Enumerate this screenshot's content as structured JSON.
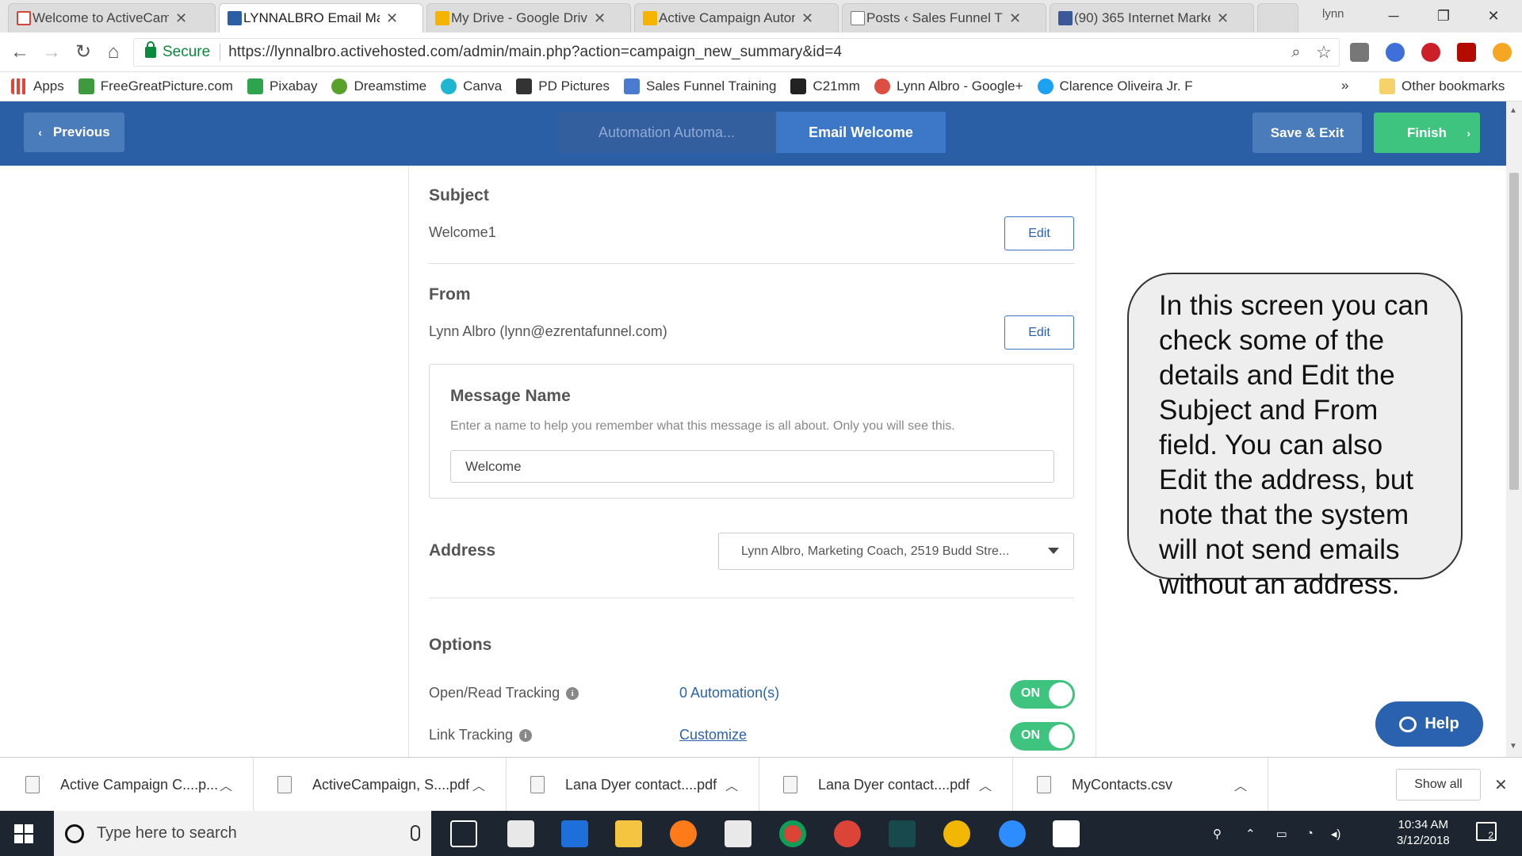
{
  "browser": {
    "tabs": [
      {
        "label": "Welcome to ActiveCam",
        "icon": "gmail-icon",
        "color": "#d44638"
      },
      {
        "label": "LYNNALBRO Email Mar",
        "icon": "activecampaign-icon",
        "color": "#2a5fa6"
      },
      {
        "label": "My Drive - Google Driv",
        "icon": "google-drive-icon",
        "color": "#f4b400"
      },
      {
        "label": "Active Campaign Auton",
        "icon": "google-slides-icon",
        "color": "#f4b400"
      },
      {
        "label": "Posts ‹ Sales Funnel Tra",
        "icon": "page-icon",
        "color": "#ffffff"
      },
      {
        "label": "(90) 365 Internet Marke",
        "icon": "facebook-icon",
        "color": "#3b5998"
      }
    ],
    "profile_name": "lynn",
    "secure_label": "Secure",
    "url": "https://lynnalbro.activehosted.com/admin/main.php?action=campaign_new_summary&id=4",
    "bookmarks": [
      {
        "label": "Apps",
        "icon": "apps-icon",
        "color": "#e0463a"
      },
      {
        "label": "FreeGreatPicture.com",
        "icon": "freegreatpicture-icon",
        "color": "#3d9b3d"
      },
      {
        "label": "Pixabay",
        "icon": "pixabay-icon",
        "color": "#2ea44f"
      },
      {
        "label": "Dreamstime",
        "icon": "dreamstime-icon",
        "color": "#5aa02c"
      },
      {
        "label": "Canva",
        "icon": "canva-icon",
        "color": "#1fb6d1"
      },
      {
        "label": "PD Pictures",
        "icon": "pd-pictures-icon",
        "color": "#333333"
      },
      {
        "label": "Sales Funnel Training",
        "icon": "document-icon",
        "color": "#4a7bd0"
      },
      {
        "label": "C21mm",
        "icon": "c21-icon",
        "color": "#222222"
      },
      {
        "label": "Lynn Albro - Google+",
        "icon": "google-plus-icon",
        "color": "#dc4e41"
      },
      {
        "label": "Clarence Oliveira Jr. F",
        "icon": "twitter-icon",
        "color": "#1da1f2"
      }
    ],
    "more_bookmarks": "»",
    "other_bookmarks": "Other bookmarks"
  },
  "app": {
    "previous_label": "Previous",
    "steps": [
      {
        "label": "Automation Automa...",
        "active": false
      },
      {
        "label": "Email Welcome",
        "active": true
      }
    ],
    "save_exit_label": "Save & Exit",
    "finish_label": "Finish"
  },
  "form": {
    "subject": {
      "title": "Subject",
      "value": "Welcome1",
      "edit_label": "Edit"
    },
    "from": {
      "title": "From",
      "value": "Lynn Albro (lynn@ezrentafunnel.com)",
      "edit_label": "Edit"
    },
    "message_name": {
      "title": "Message Name",
      "help": "Enter a name to help you remember what this message is all about. Only you will see this.",
      "value": "Welcome"
    },
    "address": {
      "title": "Address",
      "selected": "Lynn Albro, Marketing Coach, 2519 Budd Stre..."
    },
    "options": {
      "title": "Options",
      "rows": [
        {
          "label": "Open/Read Tracking",
          "link": "0 Automation(s)",
          "toggle": "ON"
        },
        {
          "label": "Link Tracking",
          "link": "Customize",
          "toggle": "ON"
        }
      ]
    }
  },
  "callout_text": "In this screen you can check some of the details and Edit the Subject and From field. You can also Edit the address, but note that the system will not send emails without an address.",
  "help_label": "Help",
  "downloads": {
    "items": [
      "Active Campaign C....p...",
      "ActiveCampaign, S....pdf",
      "Lana Dyer contact....pdf",
      "Lana Dyer contact....pdf",
      "MyContacts.csv"
    ],
    "show_all_label": "Show all"
  },
  "taskbar": {
    "search_placeholder": "Type here to search",
    "time": "10:34 AM",
    "date": "3/12/2018",
    "notification_count": "2"
  }
}
